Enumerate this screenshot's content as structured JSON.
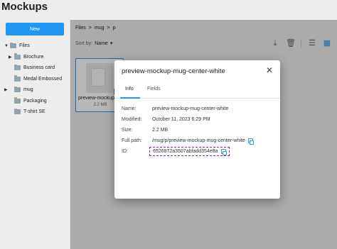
{
  "app": {
    "title": "Mockups"
  },
  "sidebar": {
    "new_label": "New",
    "tree": [
      {
        "label": "Files",
        "caret": "▼",
        "level": 0
      },
      {
        "label": "Brochure",
        "caret": "▶",
        "level": 1
      },
      {
        "label": "Business card",
        "caret": "",
        "level": 1
      },
      {
        "label": "Medal Embossed",
        "caret": "",
        "level": 1
      },
      {
        "label": "mug",
        "caret": "▶",
        "level": 1
      },
      {
        "label": "Packaging",
        "caret": "",
        "level": 1
      },
      {
        "label": "T-shirt SE",
        "caret": "",
        "level": 1
      }
    ]
  },
  "breadcrumb": {
    "items": [
      "Files",
      "mug",
      "p"
    ],
    "separator": ">"
  },
  "sort": {
    "label": "Sort by:",
    "value": "Name",
    "direction": "▾"
  },
  "toolbar": {
    "download": "⤓",
    "delete": "🗑",
    "list": "☰",
    "grid": "▦"
  },
  "file_tile": {
    "name": "preview-mockup",
    "size": "2.2 MB"
  },
  "dialog": {
    "title": "preview-mockup-mug-center-white",
    "close": "✕",
    "tabs": [
      {
        "label": "Info",
        "active": true
      },
      {
        "label": "Fields",
        "active": false
      }
    ],
    "props": {
      "name_key": "Name:",
      "name_val": "preview-mockup-mug-center-white",
      "modified_key": "Modified:",
      "modified_val": "October 11, 2023 6:29 PM",
      "size_key": "Size:",
      "size_val": "2.2 MB",
      "path_key": "Full path:",
      "path_val": "/mug/p/preview-mockup-mug-center-white",
      "id_key": "ID:",
      "id_val": "6526872a3507abfadd354e8a"
    }
  },
  "colors": {
    "accent": "#2196f3",
    "highlight": "#8e24aa"
  }
}
